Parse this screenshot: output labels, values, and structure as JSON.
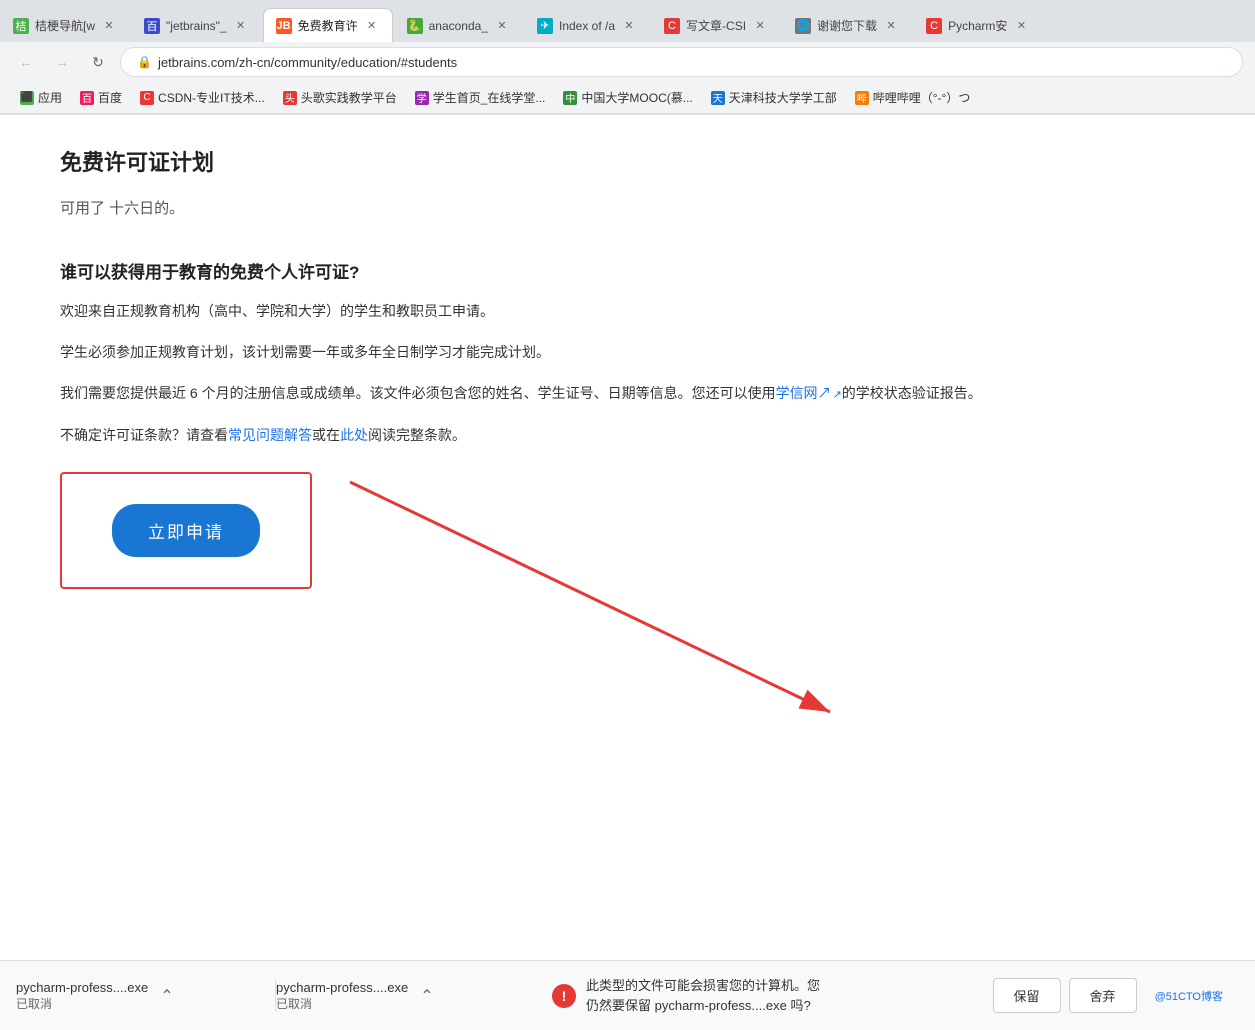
{
  "tabs": [
    {
      "id": "tab1",
      "favicon_class": "green",
      "favicon_text": "桔",
      "title": "桔梗导航[w",
      "active": false
    },
    {
      "id": "tab2",
      "favicon_class": "blue-paw",
      "favicon_text": "百",
      "title": "\"jetbrains\"_",
      "active": false
    },
    {
      "id": "tab3",
      "favicon_class": "jb-orange",
      "favicon_text": "JB",
      "title": "免费教育许",
      "active": true
    },
    {
      "id": "tab4",
      "favicon_class": "anaconda",
      "favicon_text": "🐍",
      "title": "anaconda_",
      "active": false
    },
    {
      "id": "tab5",
      "favicon_class": "teal",
      "favicon_text": "✈",
      "title": "Index of /a",
      "active": false
    },
    {
      "id": "tab6",
      "favicon_class": "red",
      "favicon_text": "C",
      "title": "写文章-CSI",
      "active": false
    },
    {
      "id": "tab7",
      "favicon_class": "grey",
      "favicon_text": "🌐",
      "title": "谢谢您下载",
      "active": false
    },
    {
      "id": "tab8",
      "favicon_class": "red",
      "favicon_text": "C",
      "title": "Pycharm安",
      "active": false
    }
  ],
  "address_bar": {
    "url": "jetbrains.com/zh-cn/community/education/#students",
    "lock_icon": "🔒"
  },
  "bookmarks": [
    {
      "id": "bm1",
      "icon_bg": "#4caf50",
      "icon_text": "⬛",
      "label": "应用"
    },
    {
      "id": "bm2",
      "icon_bg": "#e91e63",
      "icon_text": "百",
      "label": "百度"
    },
    {
      "id": "bm3",
      "icon_bg": "#e53935",
      "icon_text": "C",
      "label": "CSDN-专业IT技术..."
    },
    {
      "id": "bm4",
      "icon_bg": "#e53935",
      "icon_text": "头",
      "label": "头歌实践教学平台"
    },
    {
      "id": "bm5",
      "icon_bg": "#9c27b0",
      "icon_text": "学",
      "label": "学生首页_在线学堂..."
    },
    {
      "id": "bm6",
      "icon_bg": "#388e3c",
      "icon_text": "中",
      "label": "中国大学MOOC(慕..."
    },
    {
      "id": "bm7",
      "icon_bg": "#1976d2",
      "icon_text": "天",
      "label": "天津科技大学学工部"
    },
    {
      "id": "bm8",
      "icon_bg": "#f57c00",
      "icon_text": "哔",
      "label": "哔哩哔哩（°-°）つ"
    }
  ],
  "page": {
    "title": "免费许可证计划",
    "subtitle_fade": "可用了 十六日的。",
    "section_heading": "谁可以获得用于教育的免费个人许可证?",
    "para1": "欢迎来自正规教育机构（高中、学院和大学）的学生和教职员工申请。",
    "para2": "学生必须参加正规教育计划，该计划需要一年或多年全日制学习才能完成计划。",
    "para3_before": "我们需要您提供最近 6 个月的注册信息或成绩单。该文件必须包含您的姓名、学生证号、日期等信息。您还可以使用",
    "para3_link": "学信网↗",
    "para3_after": "的学校状态验证报告。",
    "para4_before": "不确定许可证条款？请查看",
    "para4_link1": "常见问题解答",
    "para4_mid": "或在",
    "para4_link2": "此处",
    "para4_after": "阅读完整条款。",
    "apply_button": "立即申请"
  },
  "downloads": [
    {
      "filename": "pycharm-profess....exe",
      "status": "已取消"
    },
    {
      "filename": "pycharm-profess....exe",
      "status": "已取消"
    }
  ],
  "warning": {
    "icon": "!",
    "text_line1": "此类型的文件可能会损害您的计算机。您",
    "text_line2": "仍然要保留 pycharm-profess....exe 吗?",
    "keep_btn": "保留",
    "discard_btn": "舍弃",
    "watermark": "@51CTO博客"
  }
}
